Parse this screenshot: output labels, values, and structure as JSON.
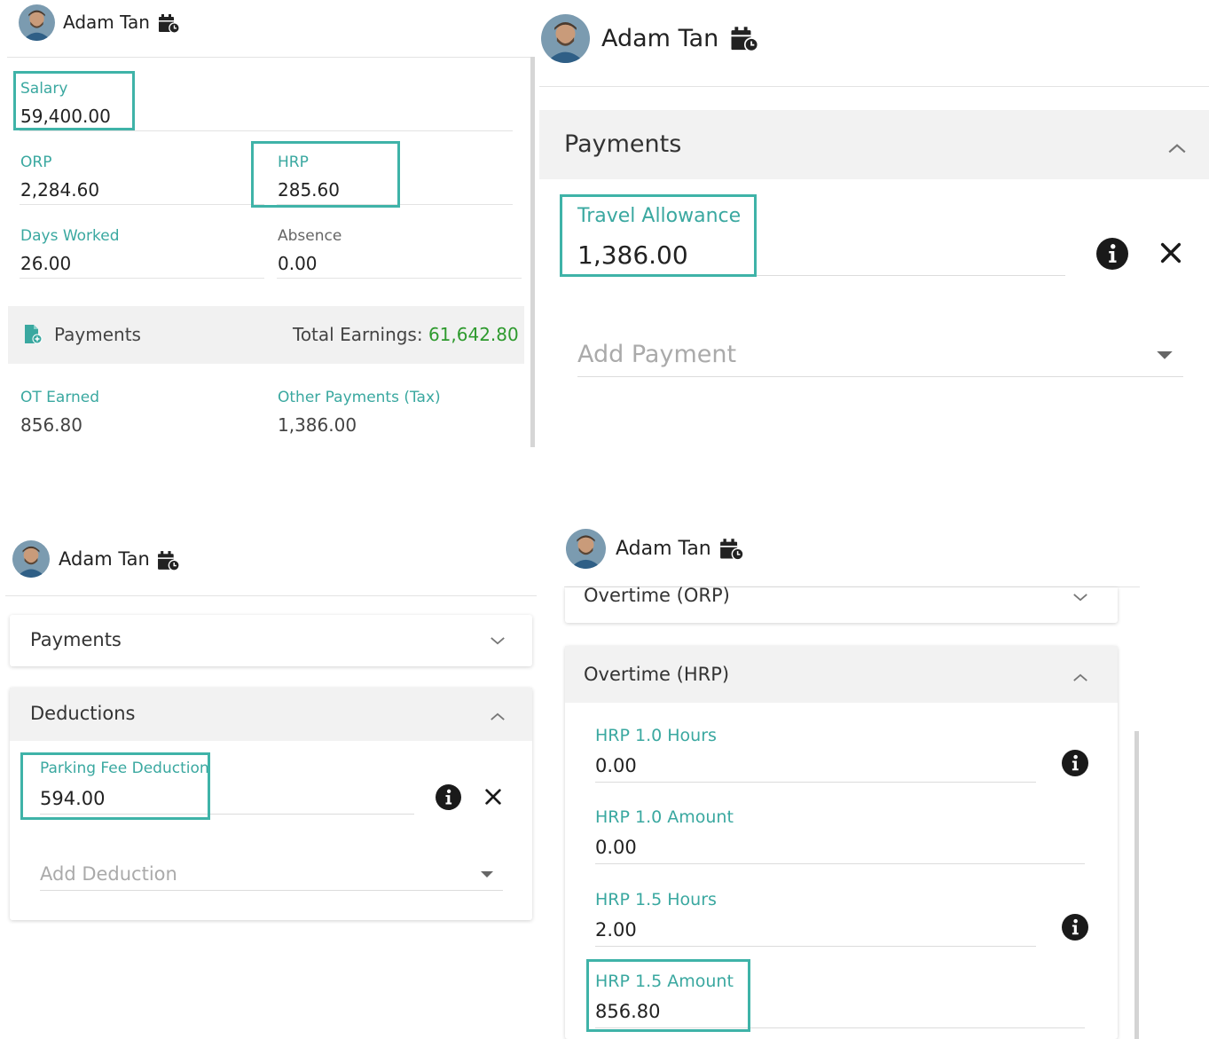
{
  "user": {
    "name": "Adam Tan"
  },
  "q1": {
    "salary": {
      "label": "Salary",
      "value": "59,400.00"
    },
    "orp": {
      "label": "ORP",
      "value": "2,284.60"
    },
    "hrp": {
      "label": "HRP",
      "value": "285.60"
    },
    "days_worked": {
      "label": "Days Worked",
      "value": "26.00"
    },
    "absence": {
      "label": "Absence",
      "value": "0.00"
    },
    "payments_bar": {
      "label": "Payments",
      "total_label": "Total Earnings:",
      "total_value": "61,642.80"
    },
    "ot_earned": {
      "label": "OT Earned",
      "value": "856.80"
    },
    "other_payments": {
      "label": "Other Payments (Tax)",
      "value": "1,386.00"
    }
  },
  "q2": {
    "section_title": "Payments",
    "travel": {
      "label": "Travel Allowance",
      "value": "1,386.00"
    },
    "add_payment": "Add Payment"
  },
  "q3": {
    "payments_title": "Payments",
    "deductions_title": "Deductions",
    "parking": {
      "label": "Parking Fee Deduction",
      "value": "594.00"
    },
    "add_deduction": "Add Deduction"
  },
  "q4": {
    "ot_orp_title": "Overtime (ORP)",
    "ot_hrp_title": "Overtime (HRP)",
    "hrp10_hours": {
      "label": "HRP 1.0 Hours",
      "value": "0.00"
    },
    "hrp10_amount": {
      "label": "HRP 1.0 Amount",
      "value": "0.00"
    },
    "hrp15_hours": {
      "label": "HRP 1.5 Hours",
      "value": "2.00"
    },
    "hrp15_amount": {
      "label": "HRP 1.5 Amount",
      "value": "856.80"
    }
  },
  "colors": {
    "teal": "#3aa8a0",
    "highlight": "#3fb3a8",
    "green": "#2e9a2e"
  },
  "icons": [
    "avatar",
    "calendar-clock-icon",
    "file-add-icon",
    "info-icon",
    "close-icon",
    "chevron-up-icon",
    "chevron-down-icon",
    "caret-down-icon"
  ]
}
